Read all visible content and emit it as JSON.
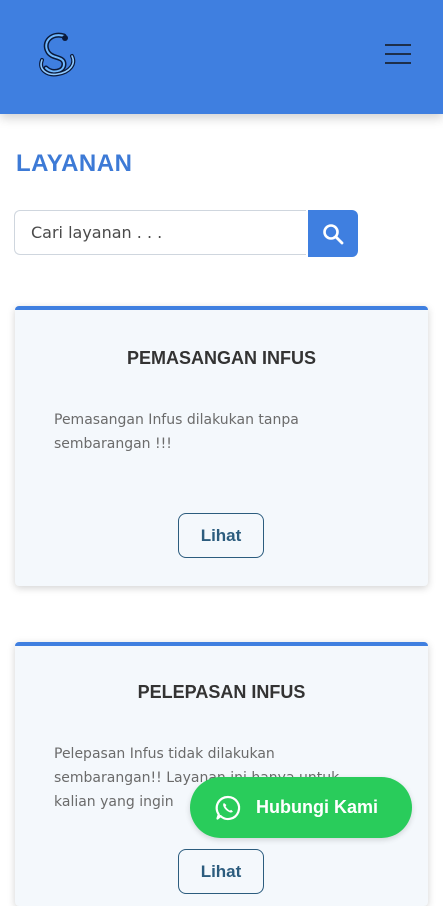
{
  "header": {
    "logo_icon": "swan-logo-icon",
    "menu_icon": "hamburger-menu-icon"
  },
  "page": {
    "title": "LAYANAN"
  },
  "search": {
    "placeholder": "Cari layanan . . .",
    "button_icon": "search-icon"
  },
  "services": [
    {
      "title": "PEMASANGAN INFUS",
      "description": "Pemasangan Infus dilakukan tanpa sembarangan !!!",
      "button_label": "Lihat"
    },
    {
      "title": "PELEPASAN INFUS",
      "description": "Pelepasan Infus tidak dilakukan sembarangan!! Layanan ini hanya untuk kalian yang ingin",
      "button_label": "Lihat"
    }
  ],
  "contact": {
    "label": "Hubungi Kami",
    "icon": "whatsapp-icon"
  },
  "colors": {
    "primary": "#3f7fe0",
    "title": "#3d7ad6",
    "whatsapp": "#29cc5b"
  }
}
